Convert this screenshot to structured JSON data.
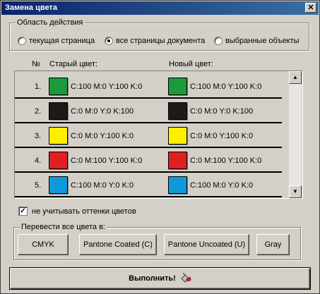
{
  "window": {
    "title": "Замена цвета",
    "close_glyph": "✕"
  },
  "scope": {
    "legend": "Область действия",
    "options": [
      {
        "label": "текущая страница",
        "selected": false
      },
      {
        "label": "все страницы документа",
        "selected": true
      },
      {
        "label": "выбранные объекты",
        "selected": false
      }
    ]
  },
  "table": {
    "col_num": "№",
    "col_old": "Старый цвет:",
    "col_new": "Новый цвет:",
    "rows": [
      {
        "num": "1.",
        "old_color": "#1a9a3a",
        "old_cmyk": "C:100 M:0 Y:100 K:0",
        "new_color": "#1a9a3a",
        "new_cmyk": "C:100 M:0 Y:100 K:0"
      },
      {
        "num": "2.",
        "old_color": "#1e1a18",
        "old_cmyk": "C:0 M:0 Y:0 K:100",
        "new_color": "#1e1a18",
        "new_cmyk": "C:0 M:0 Y:0 K:100"
      },
      {
        "num": "3.",
        "old_color": "#ffee00",
        "old_cmyk": "C:0 M:0 Y:100 K:0",
        "new_color": "#ffee00",
        "new_cmyk": "C:0 M:0 Y:100 K:0"
      },
      {
        "num": "4.",
        "old_color": "#e02020",
        "old_cmyk": "C:0 M:100 Y:100 K:0",
        "new_color": "#e02020",
        "new_cmyk": "C:0 M:100 Y:100 K:0"
      },
      {
        "num": "5.",
        "old_color": "#1098dc",
        "old_cmyk": "C:100 M:0 Y:0 K:0",
        "new_color": "#1098dc",
        "new_cmyk": "C:100 M:0 Y:0 K:0"
      }
    ]
  },
  "ignore_shades": {
    "label": "не учитывать оттенки цветов",
    "checked": true
  },
  "convert": {
    "legend": "Перевести все цвета в:",
    "buttons": [
      "CMYK",
      "Pantone Coated (C)",
      "Pantone Uncoated (U)",
      "Gray"
    ]
  },
  "execute": {
    "label": "Выполнить!",
    "icon": "paint-bucket-icon"
  }
}
